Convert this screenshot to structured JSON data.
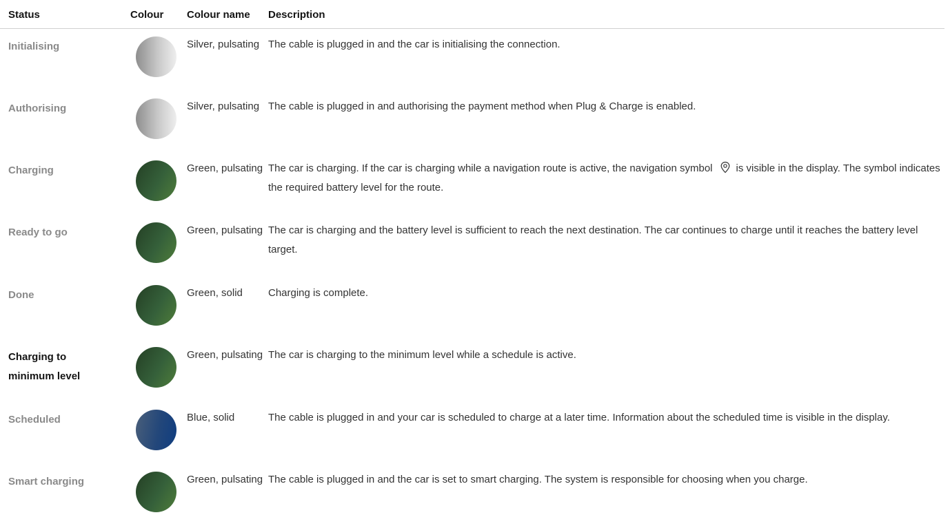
{
  "header": {
    "status": "Status",
    "colour": "Colour",
    "colour_name": "Colour name",
    "description": "Description"
  },
  "colors": {
    "silver": "#c8c8c8",
    "green": "#3a6b3a",
    "blue": "#1f4a7a"
  },
  "rows": [
    {
      "status": "Initialising",
      "colour_key": "silver",
      "colour_name": "Silver, pulsating",
      "description": "The cable is plugged in and the car is initialising the connection."
    },
    {
      "status": "Authorising",
      "colour_key": "silver",
      "colour_name": "Silver, pulsating",
      "description": "The cable is plugged in and authorising the payment method when Plug & Charge is enabled."
    },
    {
      "status": "Charging",
      "colour_key": "green",
      "colour_name": "Green, pulsating",
      "description_before_icon": "The car is charging. If the car is charging while a navigation route is active, the navigation symbol",
      "icon": "navigation-pin-icon",
      "description_after_icon": "is visible in the display. The symbol indicates the required battery level for the route."
    },
    {
      "status": "Ready to go",
      "colour_key": "green",
      "colour_name": "Green, pulsating",
      "description": "The car is charging and the battery level is sufficient to reach the next destination. The car continues to charge until it reaches the battery level target."
    },
    {
      "status": "Done",
      "colour_key": "green",
      "colour_name": "Green, solid",
      "description": "Charging is complete."
    },
    {
      "status": "Charging to minimum level",
      "colour_key": "green",
      "colour_name": "Green, pulsating",
      "description": "The car is charging to the minimum level while a schedule is active."
    },
    {
      "status": "Scheduled",
      "colour_key": "blue",
      "colour_name": "Blue, solid",
      "description": "The cable is plugged in and your car is scheduled to charge at a later time. Information about the scheduled time is visible in the display."
    },
    {
      "status": "Smart charging",
      "colour_key": "green",
      "colour_name": "Green, pulsating",
      "description": "The cable is plugged in and the car is set to smart charging. The system is responsible for choosing when you charge."
    }
  ]
}
